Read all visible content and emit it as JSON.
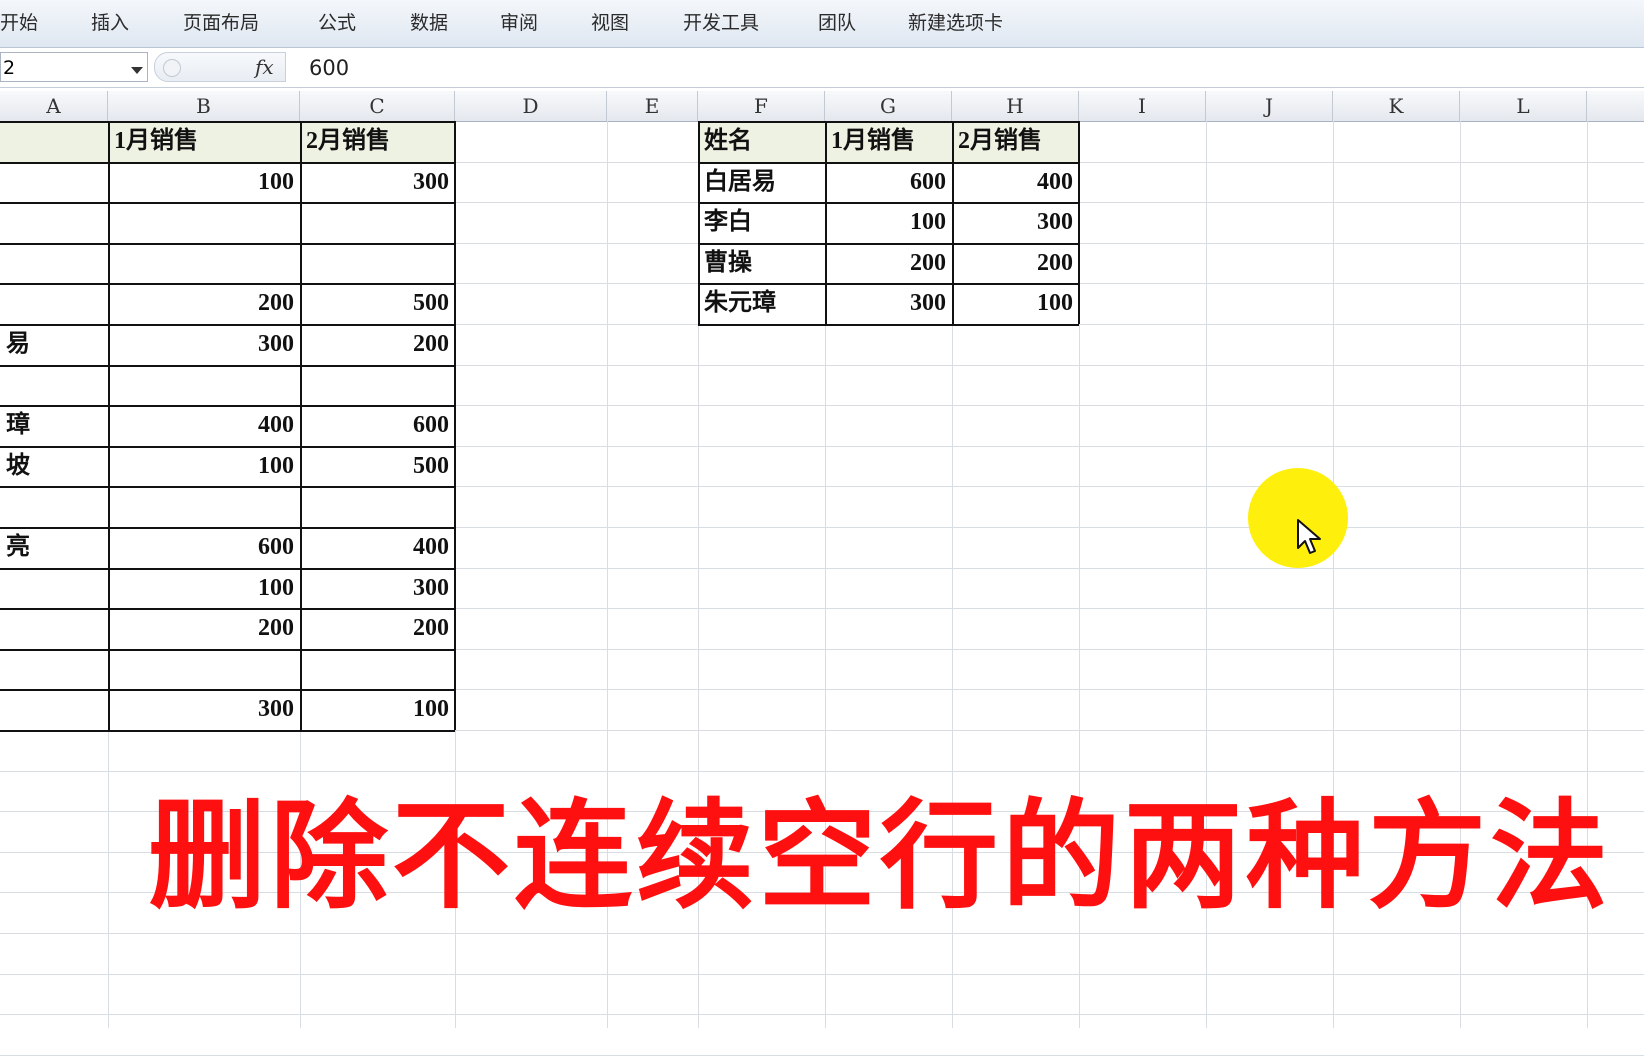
{
  "ribbon": {
    "tabs": [
      "开始",
      "插入",
      "页面布局",
      "公式",
      "数据",
      "审阅",
      "视图",
      "开发工具",
      "团队",
      "新建选项卡"
    ]
  },
  "formula_bar": {
    "name_box": "2",
    "fx_icon": "fx-icon",
    "value": "600"
  },
  "columns": [
    "A",
    "B",
    "C",
    "D",
    "E",
    "F",
    "G",
    "H",
    "I",
    "J",
    "K",
    "L"
  ],
  "left_table": {
    "headers": [
      "",
      "1月销售",
      "2月销售"
    ],
    "rows": [
      {
        "name": "",
        "jan": "100",
        "feb": "300"
      },
      {
        "name": "",
        "jan": "",
        "feb": ""
      },
      {
        "name": "",
        "jan": "",
        "feb": ""
      },
      {
        "name": "",
        "jan": "200",
        "feb": "500"
      },
      {
        "name": "易",
        "jan": "300",
        "feb": "200"
      },
      {
        "name": "",
        "jan": "",
        "feb": ""
      },
      {
        "name": "璋",
        "jan": "400",
        "feb": "600"
      },
      {
        "name": "坡",
        "jan": "100",
        "feb": "500"
      },
      {
        "name": "",
        "jan": "",
        "feb": ""
      },
      {
        "name": "亮",
        "jan": "600",
        "feb": "400"
      },
      {
        "name": "",
        "jan": "100",
        "feb": "300"
      },
      {
        "name": "",
        "jan": "200",
        "feb": "200"
      },
      {
        "name": "",
        "jan": "",
        "feb": ""
      },
      {
        "name": "",
        "jan": "300",
        "feb": "100"
      }
    ]
  },
  "right_table": {
    "headers": [
      "姓名",
      "1月销售",
      "2月销售"
    ],
    "rows": [
      {
        "name": "白居易",
        "jan": "600",
        "feb": "400"
      },
      {
        "name": "李白",
        "jan": "100",
        "feb": "300"
      },
      {
        "name": "曹操",
        "jan": "200",
        "feb": "200"
      },
      {
        "name": "朱元璋",
        "jan": "300",
        "feb": "100"
      }
    ]
  },
  "caption": "删除不连续空行的两种方法",
  "cursor": {
    "icon": "mouse-pointer-icon",
    "highlight_color": "#ffee00"
  },
  "colors": {
    "caption": "#ff1010",
    "header_fill": "#eef2e3"
  }
}
